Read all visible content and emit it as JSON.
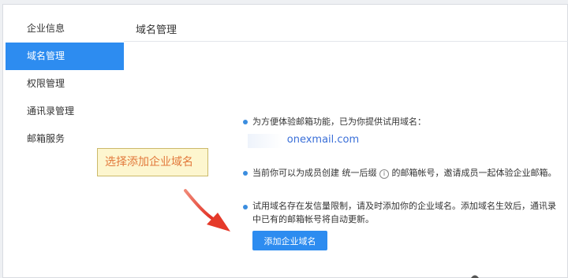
{
  "sidebar": {
    "items": [
      {
        "label": "企业信息",
        "active": false
      },
      {
        "label": "域名管理",
        "active": true
      },
      {
        "label": "权限管理",
        "active": false
      },
      {
        "label": "通讯录管理",
        "active": false
      },
      {
        "label": "邮箱服务",
        "active": false
      }
    ]
  },
  "main": {
    "title": "域名管理",
    "tip1": "为方便体验邮箱功能，已为你提供试用域名：",
    "trial_domain": "onexmail.com",
    "tip2_before": "当前你可以为成员创建 统一后缀",
    "tip2_after": "的邮箱帐号，邀请成员一起体验企业邮箱。",
    "tip3_line1": "试用域名存在发信量限制，请及时添加你的企业域名。添加域名生效后，通讯录",
    "tip3_line2": "中已有的邮箱帐号将自动更新。",
    "add_button": "添加企业域名"
  },
  "annotation": {
    "callout": "选择添加企业域名"
  },
  "colors": {
    "accent": "#2d8cf0",
    "callout_text": "#e2793c",
    "arrow": "#e53a2a"
  }
}
